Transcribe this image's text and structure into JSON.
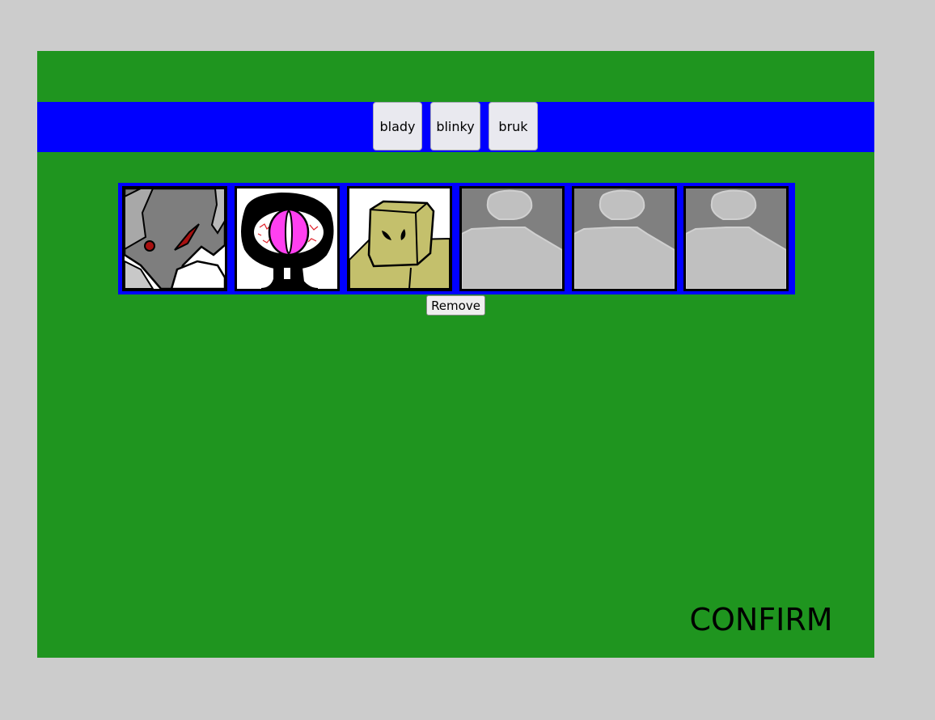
{
  "tabs": [
    {
      "label": "blady"
    },
    {
      "label": "blinky"
    },
    {
      "label": "bruk"
    }
  ],
  "slots": [
    {
      "icon": "blady-portrait-icon",
      "filled": true
    },
    {
      "icon": "blinky-portrait-icon",
      "filled": true
    },
    {
      "icon": "bruk-portrait-icon",
      "filled": true
    },
    {
      "icon": "empty-slot-icon",
      "filled": false
    },
    {
      "icon": "empty-slot-icon",
      "filled": false
    },
    {
      "icon": "empty-slot-icon",
      "filled": false
    }
  ],
  "actions": {
    "remove_label": "Remove",
    "confirm_label": "CONFIRM"
  },
  "colors": {
    "background": "#cccccc",
    "panel": "#1f951f",
    "tab_bar": "#0000ff",
    "slot_frame": "#0000ff",
    "button": "#e9e9ef"
  }
}
